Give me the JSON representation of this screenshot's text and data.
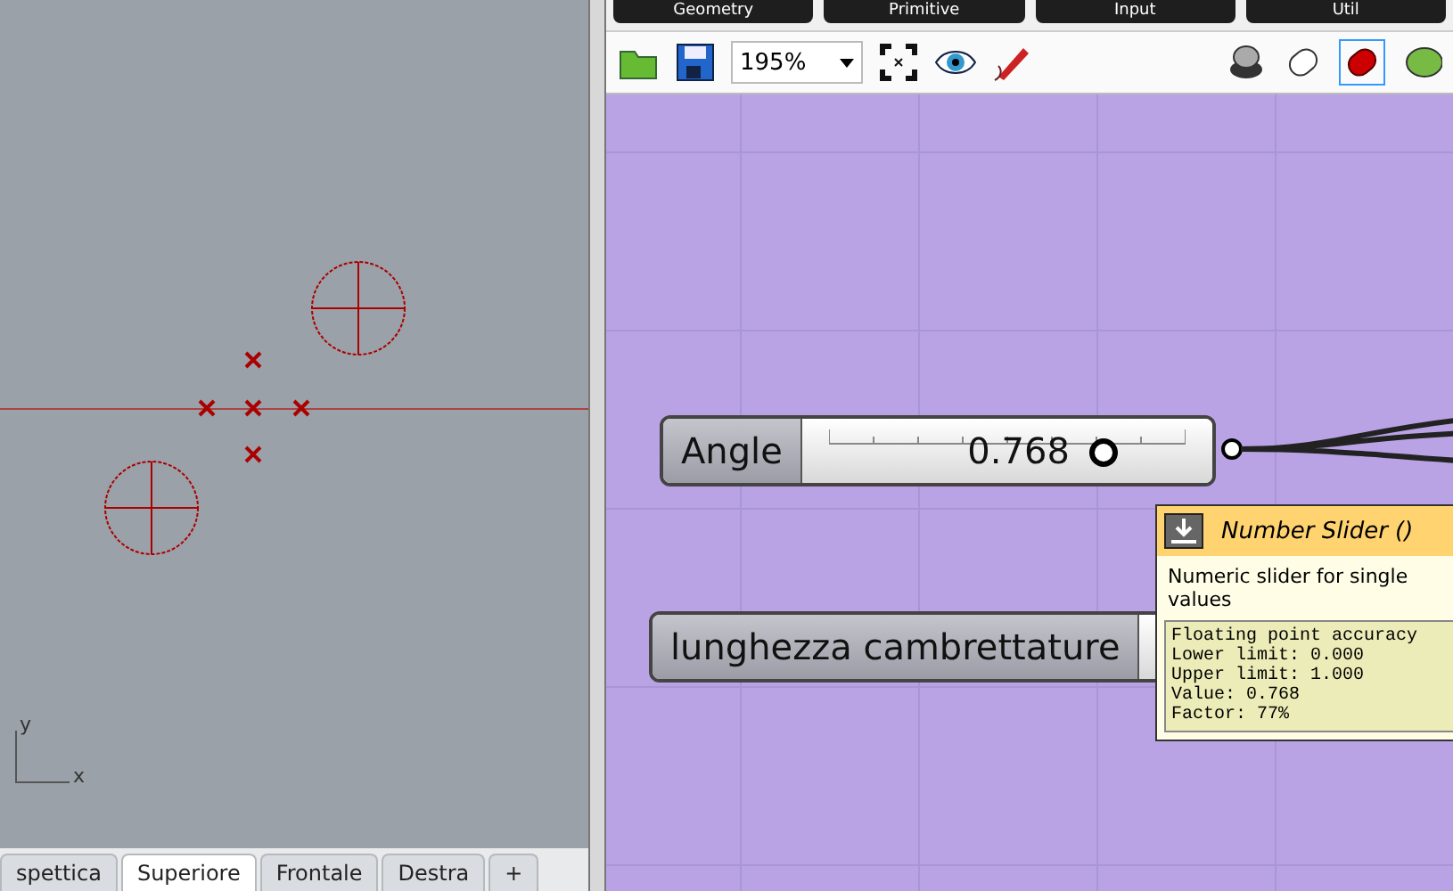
{
  "viewport": {
    "axis_y": "y",
    "axis_x": "x",
    "tabs": [
      {
        "label": "spettica",
        "selected": false
      },
      {
        "label": "Superiore",
        "selected": true
      },
      {
        "label": "Frontale",
        "selected": false
      },
      {
        "label": "Destra",
        "selected": false
      },
      {
        "label": "+",
        "selected": false
      }
    ]
  },
  "categories": [
    "Geometry",
    "Primitive",
    "Input",
    "Util"
  ],
  "toolbar": {
    "zoom": "195%"
  },
  "sliders": [
    {
      "name": "Angle",
      "value": "0.768",
      "level": 0.768
    },
    {
      "name": "lunghezza cambrettature"
    }
  ],
  "tooltip": {
    "title": "Number Slider ()",
    "description": "Numeric slider for single values",
    "details": [
      "Floating point accuracy",
      "Lower limit: 0.000",
      "Upper limit: 1.000",
      "Value: 0.768",
      "Factor: 77%"
    ]
  }
}
